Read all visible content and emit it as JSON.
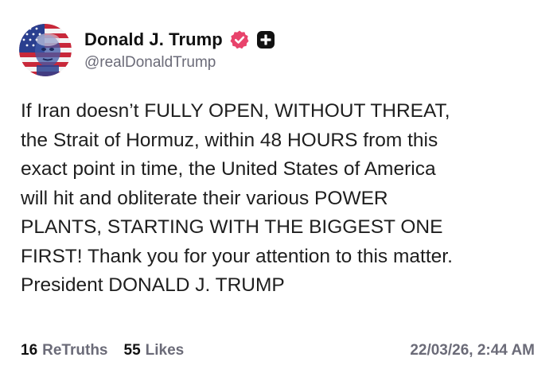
{
  "author": {
    "display_name": "Donald J. Trump",
    "handle": "@realDonaldTrump",
    "avatar_icon": "flag-portrait-avatar",
    "verified_icon": "verified-badge-icon",
    "plus_icon": "plus-badge-icon",
    "verified_color": "#e8436b"
  },
  "post": {
    "lines": [
      "If Iran doesn’t FULLY OPEN, WITHOUT THREAT,",
      "the Strait of Hormuz, within 48 HOURS from this",
      "exact point in time, the United States of America",
      "will hit and obliterate their various POWER",
      "PLANTS, STARTING WITH THE BIGGEST ONE",
      "FIRST! Thank you for your attention to this matter.",
      "President DONALD J. TRUMP"
    ]
  },
  "stats": {
    "retruths_count": "16",
    "retruths_label": "ReTruths",
    "likes_count": "55",
    "likes_label": "Likes",
    "timestamp": "22/03/26, 2:44 AM"
  }
}
